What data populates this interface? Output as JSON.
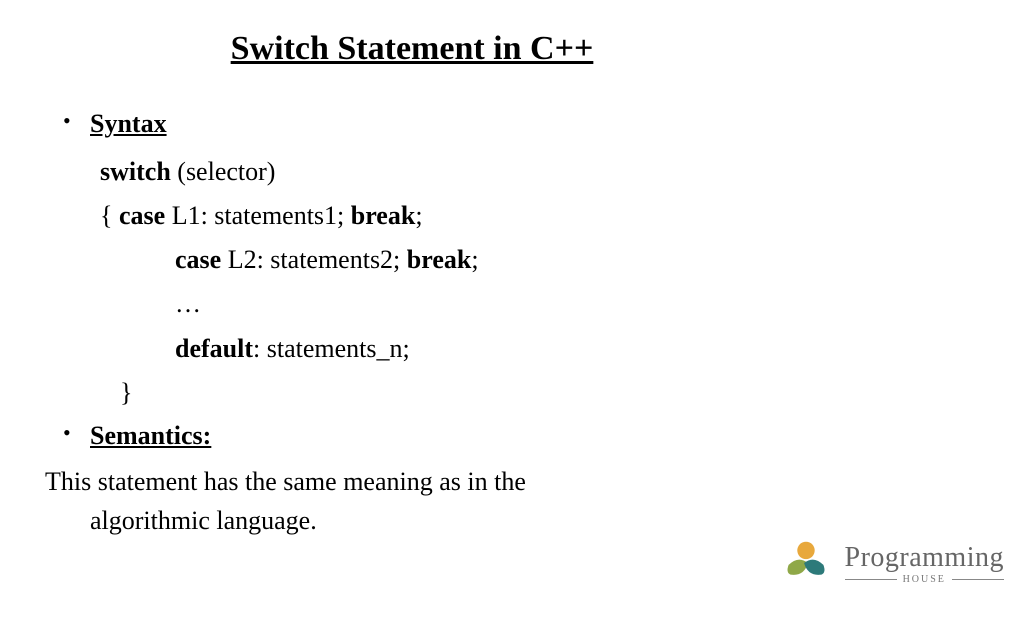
{
  "title": "Switch Statement in C++",
  "syntax": {
    "label": "Syntax",
    "line1_kw": "switch",
    "line1_rest": " (selector)",
    "line2_open": "{ ",
    "line2_kw1": "case",
    "line2_mid": " L1: statements1; ",
    "line2_kw2": "break",
    "line2_end": ";",
    "line3_kw1": "case",
    "line3_mid": " L2: statements2; ",
    "line3_kw2": "break",
    "line3_end": ";",
    "line4": "…",
    "line5_kw": "default",
    "line5_rest": ": statements_n;",
    "line6": "}"
  },
  "semantics": {
    "label": "Semantics:",
    "text": "This statement has the same meaning as in the algorithmic language."
  },
  "logo": {
    "main": "Programming",
    "sub": "HOUSE"
  }
}
